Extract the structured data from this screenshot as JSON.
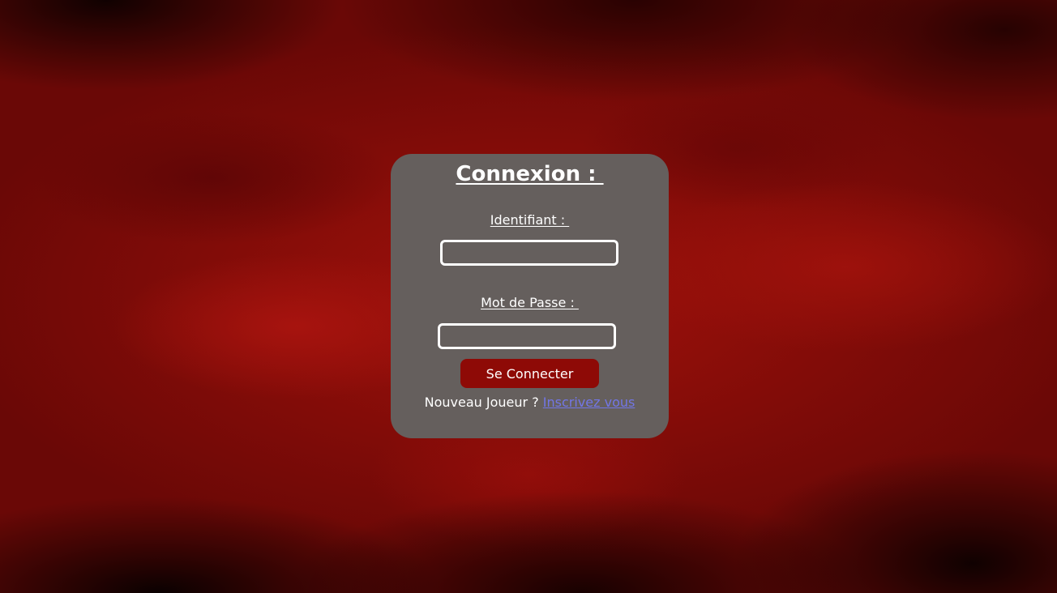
{
  "login": {
    "title": "Connexion : ",
    "username_label": "Identifiant : ",
    "username_value": "",
    "password_label": "Mot de Passe : ",
    "password_value": "",
    "submit_label": "Se Connecter",
    "signup_prompt": "Nouveau Joueur ? ",
    "signup_link": "Inscrivez vous"
  },
  "colors": {
    "card_background": "#655f5d",
    "button_background": "#8e0a06",
    "link": "#7276e6",
    "page_background": "#a0110b"
  }
}
